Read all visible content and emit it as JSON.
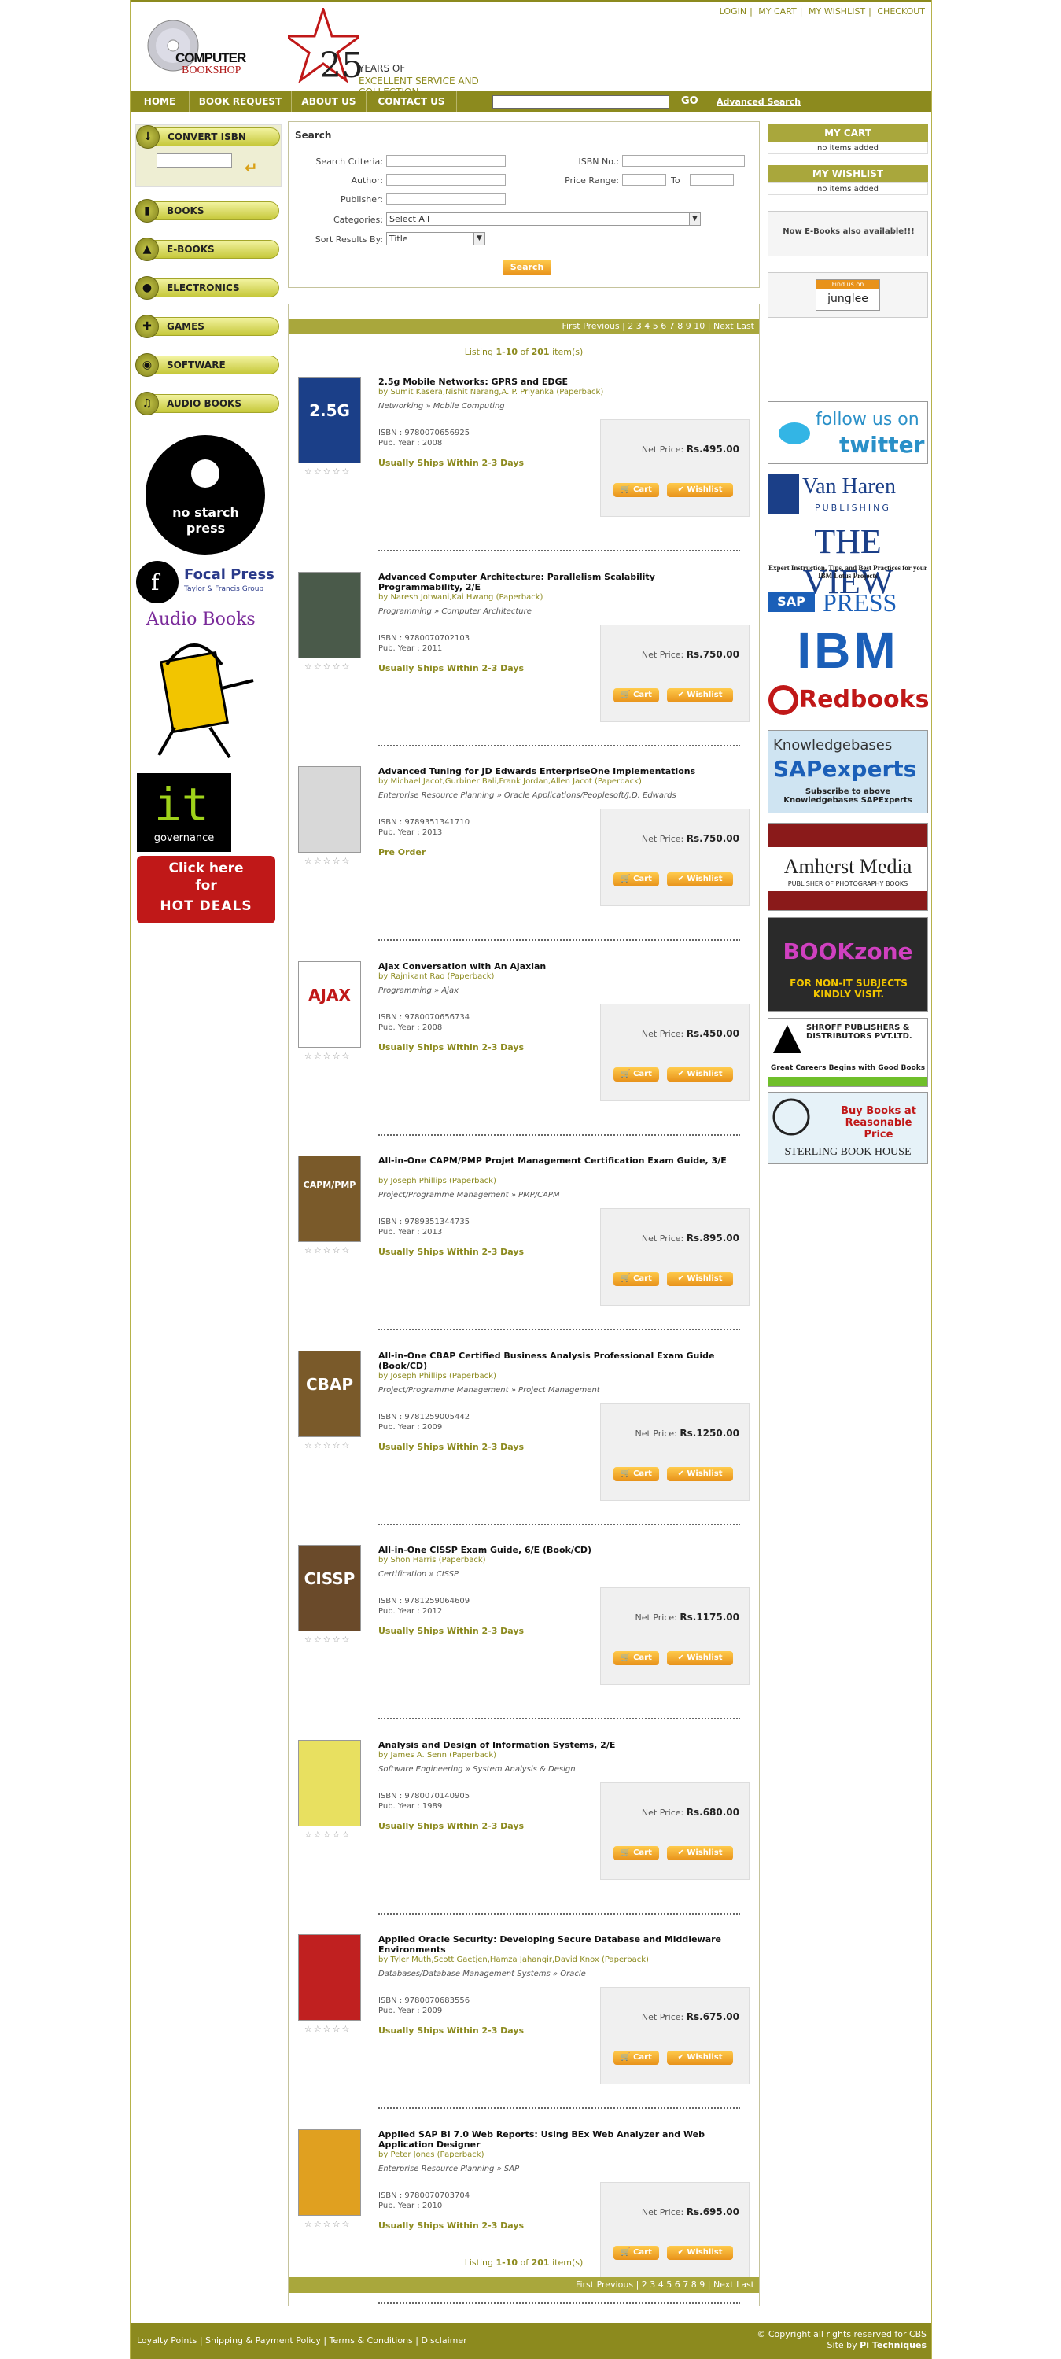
{
  "top_links": [
    "LOGIN",
    "MY CART",
    "MY WISHLIST",
    "CHECKOUT"
  ],
  "logo": {
    "line1": "COMPUTER",
    "line2": "BOOKSHOP"
  },
  "anniversary": {
    "number": "25",
    "years_of": "YEARS OF",
    "tagline": "EXCELLENT SERVICE AND COLLECTION"
  },
  "nav": {
    "items": [
      "HOME",
      "BOOK REQUEST",
      "ABOUT US",
      "CONTACT US"
    ],
    "search_placeholder": "",
    "go": "GO",
    "advanced": "Advanced Search"
  },
  "left": {
    "convert_isbn": "CONVERT ISBN",
    "categories": [
      "BOOKS",
      "E-BOOKS",
      "ELECTRONICS",
      "GAMES",
      "SOFTWARE",
      "AUDIO BOOKS"
    ],
    "logos": {
      "nostarch": [
        "no starch",
        "press"
      ],
      "focal": [
        "Focal Press",
        "Taylor & Francis Group"
      ],
      "audiobooks": "Audio Books",
      "governance": "governance",
      "hotdeals": [
        "Click here",
        "for",
        "HOT DEALS"
      ]
    }
  },
  "search": {
    "title": "Search",
    "labels": {
      "criteria": "Search Criteria:",
      "isbn": "ISBN No.:",
      "author": "Author:",
      "price": "Price Range:",
      "to": "To",
      "publisher": "Publisher:",
      "categories": "Categories:",
      "sort": "Sort Results By:"
    },
    "categories_value": "Select All",
    "sort_value": "Title",
    "button": "Search"
  },
  "pager": {
    "first_prev": "First Previous",
    "pages_top": "2 3 4 5 6 7 8 9 10",
    "pages_bottom": "2 3 4 5 6 7 8 9",
    "next_last": "Next Last"
  },
  "listing": {
    "prefix": "Listing",
    "range": "1-10",
    "of": "of",
    "total": "201",
    "suffix": "item(s)"
  },
  "labels": {
    "net_price": "Net Price:",
    "cart": "Cart",
    "wishlist": "Wishlist",
    "isbn": "ISBN :",
    "pub_year": "Pub. Year :",
    "stars": "☆☆☆☆☆"
  },
  "items": [
    {
      "title": "2.5g Mobile Networks: GPRS and EDGE",
      "authors": "by Sumit Kasera,Nishit Narang,A. P. Priyanka (Paperback)",
      "category": "Networking » Mobile Computing",
      "isbn": "9780070656925",
      "year": "2008",
      "ship": "Usually Ships Within 2-3 Days",
      "price": "Rs.495.00",
      "cover": "#1b3f88",
      "cover_text": "2.5G",
      "title_lines": 1
    },
    {
      "title": "Advanced Computer Architecture: Parallelism Scalability Programmability, 2/E",
      "authors": "by Naresh Jotwani,Kai Hwang (Paperback)",
      "category": "Programming » Computer Architecture",
      "isbn": "9780070702103",
      "year": "2011",
      "ship": "Usually Ships Within 2-3 Days",
      "price": "Rs.750.00",
      "cover": "#4a5a4a",
      "cover_text": "",
      "title_lines": 2
    },
    {
      "title": "Advanced Tuning for JD Edwards EnterpriseOne Implementations",
      "authors": "by Michael Jacot,Gurbiner Bali,Frank Jordan,Allen Jacot (Paperback)",
      "category": "Enterprise Resource Planning » Oracle Applications/Peoplesoft/J.D. Edwards",
      "isbn": "9789351341710",
      "year": "2013",
      "ship": "Pre Order",
      "price": "Rs.750.00",
      "cover": "#d8d8d8",
      "cover_text": "",
      "title_lines": 1
    },
    {
      "title": "Ajax Conversation with An Ajaxian",
      "authors": "by Rajnikant Rao (Paperback)",
      "category": "Programming » Ajax",
      "isbn": "9780070656734",
      "year": "2008",
      "ship": "Usually Ships Within 2-3 Days",
      "price": "Rs.450.00",
      "cover": "#ffffff",
      "cover_text": "AJAX",
      "title_lines": 1
    },
    {
      "title": "All-in-One CAPM/PMP Projet Management Certification Exam Guide, 3/E",
      "authors": "by Joseph Phillips (Paperback)",
      "category": "Project/Programme Management » PMP/CAPM",
      "isbn": "9789351344735",
      "year": "2013",
      "ship": "Usually Ships Within 2-3 Days",
      "price": "Rs.895.00",
      "cover": "#7a5a2a",
      "cover_text": "CAPM/PMP",
      "title_lines": 2
    },
    {
      "title": "All-in-One CBAP Certified Business Analysis Professional Exam Guide (Book/CD)",
      "authors": "by Joseph Phillips (Paperback)",
      "category": "Project/Programme Management » Project Management",
      "isbn": "9781259005442",
      "year": "2009",
      "ship": "Usually Ships Within 2-3 Days",
      "price": "Rs.1250.00",
      "cover": "#7a5a2a",
      "cover_text": "CBAP",
      "title_lines": 2
    },
    {
      "title": "All-in-One CISSP Exam Guide, 6/E (Book/CD)",
      "authors": "by Shon Harris (Paperback)",
      "category": "Certification » CISSP",
      "isbn": "9781259064609",
      "year": "2012",
      "ship": "Usually Ships Within 2-3 Days",
      "price": "Rs.1175.00",
      "cover": "#6a4a2a",
      "cover_text": "CISSP",
      "title_lines": 1
    },
    {
      "title": "Analysis and Design of Information Systems, 2/E",
      "authors": "by James A. Senn (Paperback)",
      "category": "Software Engineering » System Analysis & Design",
      "isbn": "9780070140905",
      "year": "1989",
      "ship": "Usually Ships Within 2-3 Days",
      "price": "Rs.680.00",
      "cover": "#e8e060",
      "cover_text": "",
      "title_lines": 1
    },
    {
      "title": "Applied Oracle Security: Developing Secure Database and Middleware Environments",
      "authors": "by Tyler Muth,Scott Gaetjen,Hamza Jahangir,David Knox (Paperback)",
      "category": "Databases/Database Management Systems » Oracle",
      "isbn": "9780070683556",
      "year": "2009",
      "ship": "Usually Ships Within 2-3 Days",
      "price": "Rs.675.00",
      "cover": "#c02020",
      "cover_text": "",
      "title_lines": 2
    },
    {
      "title": "Applied SAP BI 7.0 Web Reports: Using BEx Web Analyzer and Web Application Designer",
      "authors": "by Peter Jones (Paperback)",
      "category": "Enterprise Resource Planning » SAP",
      "isbn": "9780070703704",
      "year": "2010",
      "ship": "Usually Ships Within 2-3 Days",
      "price": "Rs.695.00",
      "cover": "#e0a020",
      "cover_text": "",
      "title_lines": 2
    }
  ],
  "right": {
    "my_cart": "MY CART",
    "cart_status": "no items added",
    "my_wishlist": "MY WISHLIST",
    "wishlist_status": "no items added",
    "ebooks_note": "Now E-Books also available!!!",
    "findus": [
      "Find us on",
      "junglee"
    ],
    "twitter": [
      "follow us on",
      "twitter"
    ],
    "vanharen": [
      "Van Haren",
      "PUBLISHING"
    ],
    "theview": [
      "THE VIEW",
      "Expert Instruction, Tips, and Best Practices for your IBM Lotus Projects"
    ],
    "sappress": [
      "SAP",
      "PRESS"
    ],
    "ibm": "IBM",
    "redbooks": "Redbooks",
    "knowledgebases": [
      "Knowledgebases",
      "SAPexperts",
      "Subscribe to above Knowledgebases SAPExperts"
    ],
    "amherst": [
      "Amherst Media",
      "PUBLISHER OF PHOTOGRAPHY BOOKS"
    ],
    "bookzone": [
      "BOOKzone",
      "FOR NON-IT SUBJECTS KINDLY VISIT."
    ],
    "shroff": [
      "SHROFF PUBLISHERS & DISTRIBUTORS PVT.LTD.",
      "Great Careers Begins with Good Books"
    ],
    "sterling": [
      "Buy Books at Reasonable Price",
      "STERLING BOOK HOUSE"
    ]
  },
  "footer": {
    "links": "Loyalty Points | Shipping & Payment Policy | Terms & Conditions | Disclaimer",
    "copyright": "© Copyright all rights reserved for CBS",
    "site_by_prefix": "Site by",
    "site_by": "Pi Techniques"
  }
}
